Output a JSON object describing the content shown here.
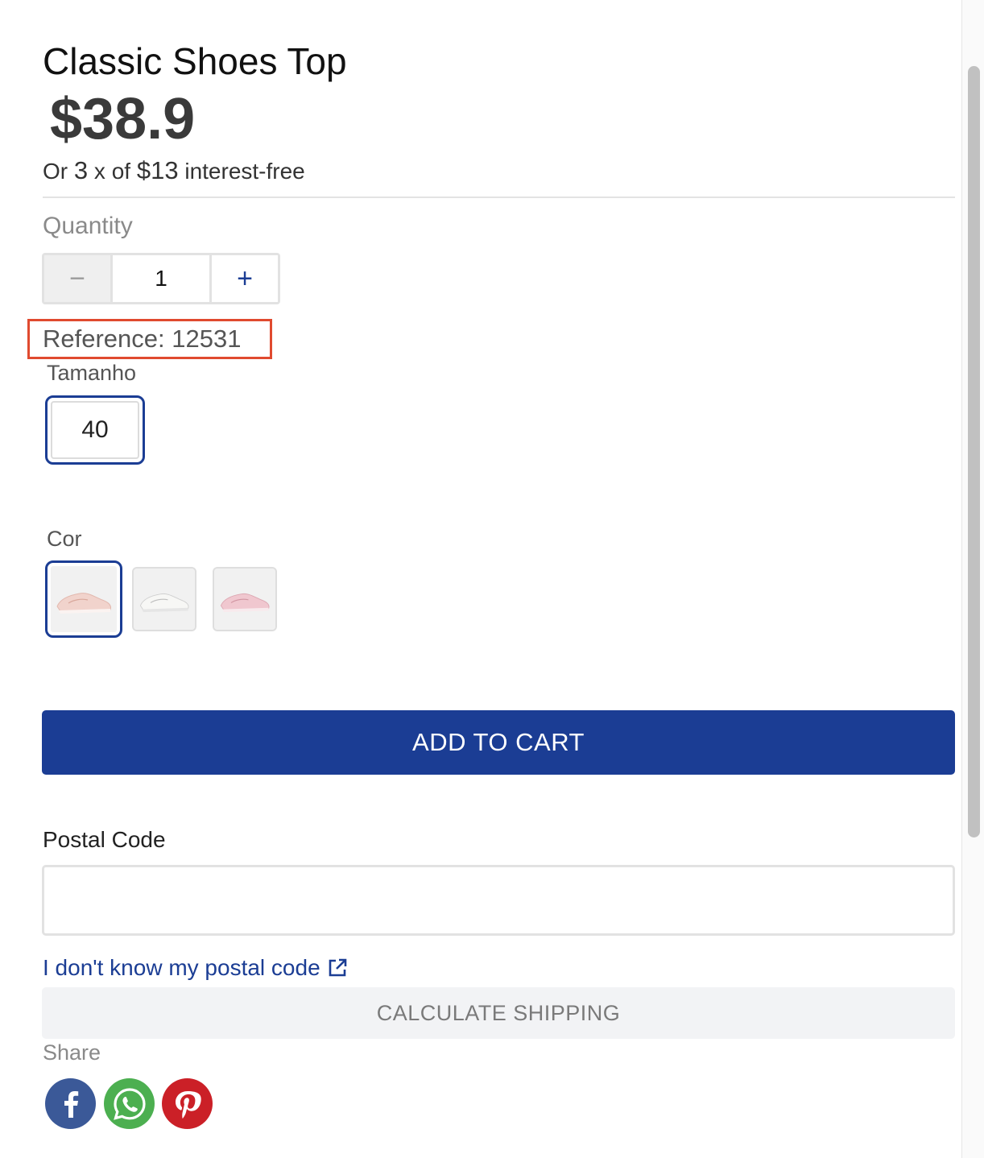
{
  "product": {
    "title": "Classic Shoes Top",
    "price": "$38.9",
    "installments": {
      "prefix": "Or",
      "count": "3",
      "middle": "x of",
      "amount": "$13",
      "suffix": "interest-free"
    },
    "reference": "Reference: 12531"
  },
  "quantity": {
    "label": "Quantity",
    "minus": "−",
    "value": "1",
    "plus": "+"
  },
  "size": {
    "label": "Tamanho",
    "options": [
      "40"
    ],
    "selected": "40"
  },
  "color": {
    "label": "Cor",
    "swatches": [
      {
        "name": "light-pink-sneaker",
        "selected": true
      },
      {
        "name": "white-sneaker",
        "selected": false
      },
      {
        "name": "pink-sneaker",
        "selected": false
      }
    ]
  },
  "actions": {
    "add_to_cart": "ADD TO CART"
  },
  "shipping": {
    "postal_label": "Postal Code",
    "postal_value": "",
    "postal_link": "I don't know my postal code",
    "calculate": "CALCULATE SHIPPING"
  },
  "share": {
    "label": "Share",
    "networks": [
      "facebook-icon",
      "whatsapp-icon",
      "pinterest-icon"
    ]
  },
  "colors": {
    "brand_blue": "#1b3d94",
    "highlight_red": "#e04a2f",
    "facebook": "#3b5998",
    "whatsapp": "#4caf50",
    "pinterest": "#cb2027"
  }
}
